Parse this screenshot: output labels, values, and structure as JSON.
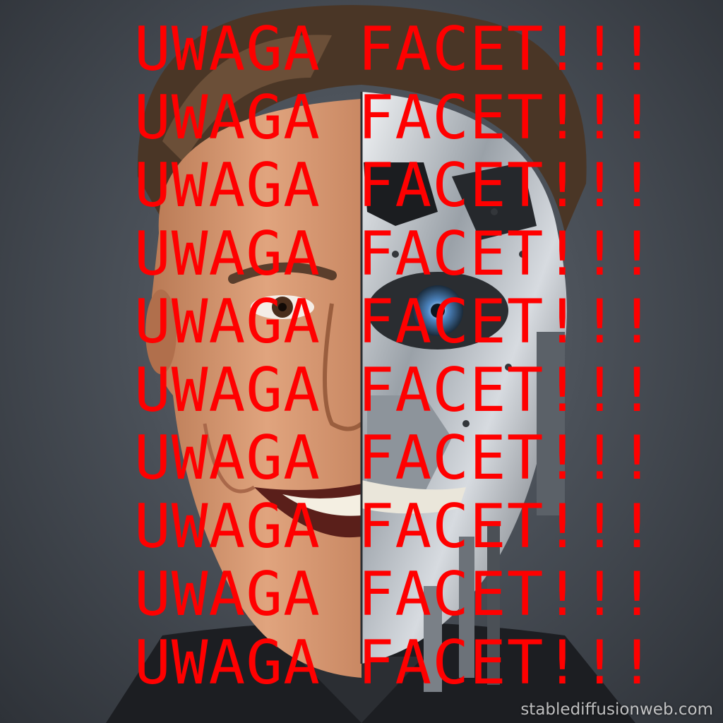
{
  "overlay": {
    "lines": [
      "UWAGA FACET!!!",
      "UWAGA FACET!!!",
      "UWAGA FACET!!!",
      "UWAGA FACET!!!",
      "UWAGA FACET!!!",
      "UWAGA FACET!!!",
      "UWAGA FACET!!!",
      "UWAGA FACET!!!",
      "UWAGA FACET!!!",
      "UWAGA FACET!!!"
    ],
    "color": "#ff0000"
  },
  "watermark": {
    "text": "stablediffusionweb.com"
  },
  "subject": {
    "left_half": "human-face",
    "right_half": "robot-face"
  }
}
